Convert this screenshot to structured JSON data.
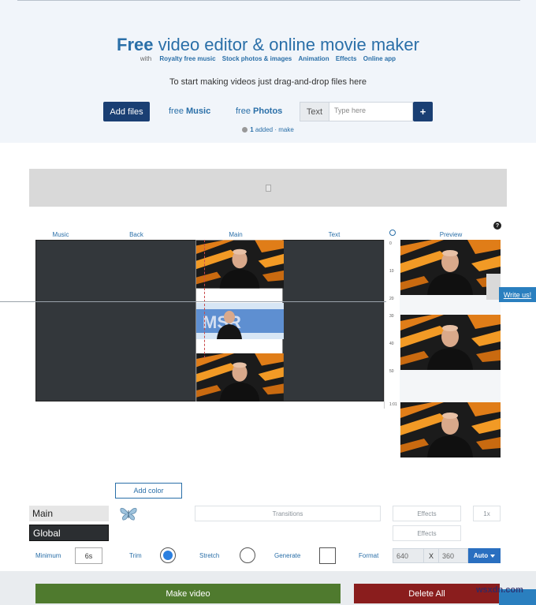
{
  "header": {
    "title_bold_1": "Free",
    "title_rest_1": " video editor & ",
    "title_bold_2": "online movie maker",
    "with_label": "with",
    "features": [
      "Royalty free music",
      "Stock photos & images",
      "Animation",
      "Effects",
      "Online app"
    ],
    "subtitle": "To start making videos just drag-and-drop files here"
  },
  "toolbar": {
    "add_files": "Add files",
    "music_prefix": "free ",
    "music_label": "Music",
    "photos_prefix": "free ",
    "photos_label": "Photos",
    "text_label": "Text",
    "text_placeholder": "Type here",
    "plus": "+",
    "added_count": "1",
    "added_text": " added · make"
  },
  "columns": {
    "music": "Music",
    "back": "Back",
    "main": "Main",
    "text": "Text",
    "preview": "Preview"
  },
  "help_icon": "?",
  "ruler_ticks": [
    "0",
    "10",
    "20",
    "30",
    "40",
    "50",
    "1:01"
  ],
  "write_us": "Write us!",
  "controls": {
    "add_color": "Add color",
    "option_main": "Main",
    "option_global": "Global",
    "transitions": "Transitions",
    "effects_1": "Effects",
    "effects_2": "Effects",
    "speed": "1x",
    "minimum_label": "Minimum",
    "minimum_value": "6s",
    "trim_label": "Trim",
    "stretch_label": "Stretch",
    "generate_label": "Generate",
    "format_label": "Format",
    "width": "640",
    "x": "X",
    "height": "360",
    "auto": "Auto"
  },
  "footer": {
    "make_video": "Make video",
    "delete_all": "Delete All"
  },
  "watermark": "wsxdn.com",
  "colors": {
    "accent": "#2a6fa8",
    "primary_button": "#1a3f73",
    "make_video": "#4f7a2e",
    "delete_all": "#8a1d1d",
    "timeline_bg": "#33373b"
  }
}
